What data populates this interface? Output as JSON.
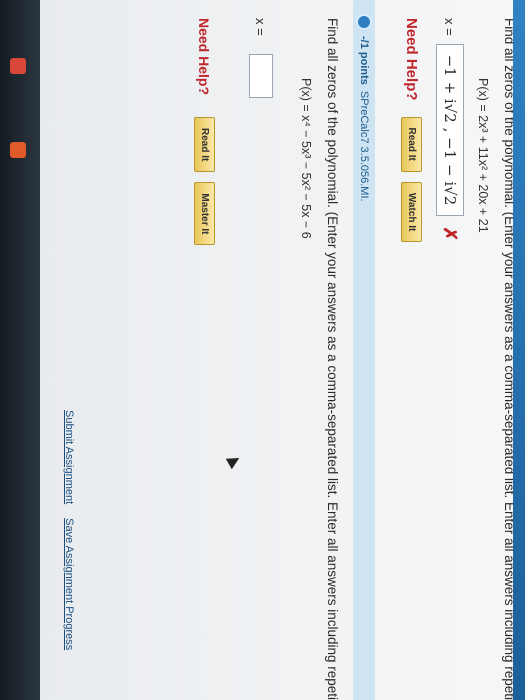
{
  "taskbar": {
    "icons": [
      {
        "name": "gmail-icon",
        "color": "#d9473a"
      },
      {
        "name": "app-icon",
        "color": "#e05a2a"
      }
    ]
  },
  "question1": {
    "prompt": "Find all zeros of the polynomial. (Enter your answers as a comma-separated list. Enter all answers including repetitions.)",
    "polynomial": "P(x) = 2x³ + 11x² + 20x + 21",
    "x_label": "x =",
    "answer": "−1 + i√2 , −1 − i√2",
    "result_mark": "✗",
    "need_help": "Need Help?",
    "buttons": [
      "Read It",
      "Watch It"
    ]
  },
  "question2_header": {
    "points": "-/1 points",
    "source": "SPreCalc7 3.5.056.MI."
  },
  "question2": {
    "prompt": "Find all zeros of the polynomial. (Enter your answers as a comma-separated list. Enter all answers including repetitions.)",
    "polynomial": "P(x) = x⁴ − 5x³ − 5x² − 5x − 6",
    "x_label": "x =",
    "answer": "",
    "need_help": "Need Help?",
    "buttons": [
      "Read It",
      "Master It"
    ]
  },
  "footer": {
    "submit": "Submit Assignment",
    "save": "Save Assignment Progress"
  }
}
